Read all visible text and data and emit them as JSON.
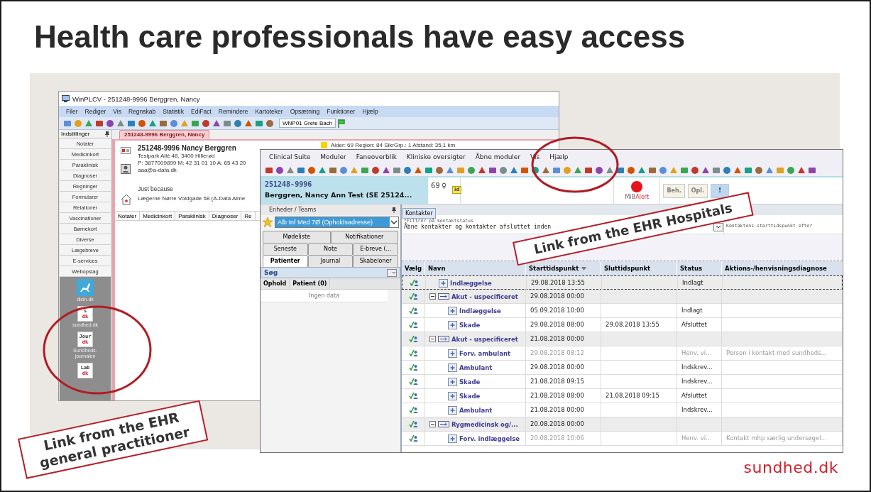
{
  "slide": {
    "title": "Health care professionals have easy access",
    "logo": "sundhed.dk"
  },
  "gp_window": {
    "title": "WinPLCV - 251248-9996 Berggren, Nancy",
    "menu": [
      "Filer",
      "Rediger",
      "Vis",
      "Regnskab",
      "Statistik",
      "EdiFact",
      "Remindere",
      "Kartoteker",
      "Opsætning",
      "Funktioner",
      "Hjælp"
    ],
    "user": "WNP01 Grete Bach",
    "sidebar_title": "Indstillinger",
    "sidebar_items": [
      "Notater",
      "Medicinkort",
      "Paraklinisk",
      "Diagnoser",
      "Regninger",
      "Formularer",
      "Relationer",
      "Vaccinationer",
      "Børnekort",
      "Diverse",
      "Lægebreve",
      "E-services",
      "Webopslag"
    ],
    "weblinks": [
      {
        "kind": "picture",
        "label": "dicin.dk"
      },
      {
        "kind": "logo",
        "logo": [
          "s",
          "dk"
        ],
        "label": "sundhed.dk"
      },
      {
        "kind": "logo",
        "logo": [
          "Jour",
          "dk"
        ],
        "label": "Sundheds-journalen"
      },
      {
        "kind": "logo",
        "logo": [
          "Lab",
          "dk"
        ]
      }
    ],
    "tabs": [
      {
        "label": "251248-9996 Berggren, Nancy",
        "selected": true
      }
    ],
    "patient": {
      "name": "251248-9996 Nancy Berggren",
      "address": "Testpark Allé 48, 3400 Hillerød",
      "phones": "P: 3877009899 M: 42 31 01 10 A: 65 43 20",
      "email": "aaa@a-data.dk",
      "note": "Just because",
      "clinic": "Lægerne Nørre Voldgade 58  (A-Data Alme",
      "summary": "Alder: 69   Region: 84   SikrGrp.: 1   Afstand: 35,1 km"
    },
    "record_tabs": [
      "Notater",
      "Medicinkort",
      "Paraklinisk",
      "Diagnoser",
      "Re"
    ]
  },
  "hospital_window": {
    "menu": [
      "Clinical Suite",
      "Moduler",
      "Faneoverblik",
      "Kliniske oversigter",
      "Åbne moduler",
      "Vis",
      "Hjælp"
    ],
    "patient": {
      "cpr": "251248-9996",
      "name": "Berggren, Nancy Ann Test (SE 25124...",
      "age": "69",
      "sex": "♀",
      "badge": "id"
    },
    "alert": [
      "MiB",
      "Alert"
    ],
    "buttons": [
      {
        "label": "Beh.",
        "disabled": true
      },
      {
        "label": "Opl.",
        "disabled": true
      },
      {
        "label": "!",
        "disabled": false
      }
    ],
    "left_pane": {
      "title": "Enheder / Teams",
      "unit": "Alb Inf Med 7Ø (Opholdsadresse)",
      "tab_rows": [
        [
          {
            "label": "Mødeliste",
            "selected": false
          },
          {
            "label": "Notifikationer",
            "selected": false
          }
        ],
        [
          {
            "label": "Seneste",
            "selected": false
          },
          {
            "label": "Note",
            "selected": false
          },
          {
            "label": "E-breve (...",
            "selected": false
          }
        ],
        [
          {
            "label": "Patienter",
            "selected": true
          },
          {
            "label": "Journal",
            "selected": false
          },
          {
            "label": "Skabeloner",
            "selected": false
          }
        ]
      ],
      "search_title": "Søg",
      "columns": [
        "Ophold",
        "Patient (0)"
      ],
      "empty": "Ingen data"
    },
    "contacts": {
      "tab": "Kontakter",
      "filter_label": "*Filtrér på kontaktstatus",
      "filter_value": "Åbne kontakter og kontakter afsluttet inden",
      "start_label": "Kontaktens starttidspunkt efter",
      "columns": [
        "Vælg",
        "Navn",
        "Starttidspunkt",
        "Sluttidspunkt",
        "Status",
        "Aktions-/henvisningsdiagnose"
      ],
      "rows": [
        {
          "kind": "contact",
          "name": "Indlæggelse",
          "start": "29.08.2018 13:55",
          "status": "Indlagt",
          "selected": true,
          "planned": false
        },
        {
          "kind": "group",
          "name": "Akut - uspecificeret",
          "start": "29.08.2018 00:00",
          "selected": false,
          "planned": false,
          "expanded": true,
          "children": [
            {
              "kind": "contact",
              "name": "Indlæggelse",
              "start": "05.09.2018 10:00",
              "status": "Indlagt",
              "selected": false,
              "planned": false
            },
            {
              "kind": "contact",
              "name": "Skade",
              "start": "29.08.2018 08:00",
              "end": "29.08.2018 13:55",
              "status": "Afsluttet",
              "selected": false,
              "planned": false
            }
          ]
        },
        {
          "kind": "group",
          "name": "Akut - uspecificeret",
          "start": "21.08.2018 00:00",
          "selected": false,
          "planned": false,
          "expanded": true,
          "children": [
            {
              "kind": "contact",
              "name": "Forv. ambulant",
              "start": "29.08.2018 08:12",
              "status": "Henv. vi...",
              "diagnosis": "Person i kontakt med sundheds...",
              "selected": false,
              "planned": true
            },
            {
              "kind": "contact",
              "name": "Ambulant",
              "start": "29.08.2018 00:00",
              "status": "Indskrev...",
              "selected": false,
              "planned": false
            },
            {
              "kind": "contact",
              "name": "Skade",
              "start": "21.08.2018 09:15",
              "status": "Indskrev...",
              "selected": false,
              "planned": false
            },
            {
              "kind": "contact",
              "name": "Skade",
              "start": "21.08.2018 08:00",
              "end": "21.08.2018 09:15",
              "status": "Afsluttet",
              "selected": false,
              "planned": false
            },
            {
              "kind": "contact",
              "name": "Ambulant",
              "start": "21.08.2018 00:00",
              "status": "Indskrev...",
              "selected": false,
              "planned": false
            }
          ]
        },
        {
          "kind": "group",
          "name": "Rygmedicinsk og/...",
          "start": "20.08.2018 00:00",
          "selected": false,
          "planned": false,
          "expanded": true,
          "children": [
            {
              "kind": "contact",
              "name": "Forv. indlæggelse",
              "start": "20.08.2018 10:06",
              "status": "Henv. vi...",
              "diagnosis": "Kontakt mhp særlig undersøgel...",
              "selected": false,
              "planned": true
            }
          ]
        }
      ]
    }
  },
  "callouts": [
    {
      "kind": "hospital",
      "text": "Link from the EHR Hospitals"
    },
    {
      "kind": "gp",
      "text": "Link from the EHR general practitioner"
    }
  ]
}
